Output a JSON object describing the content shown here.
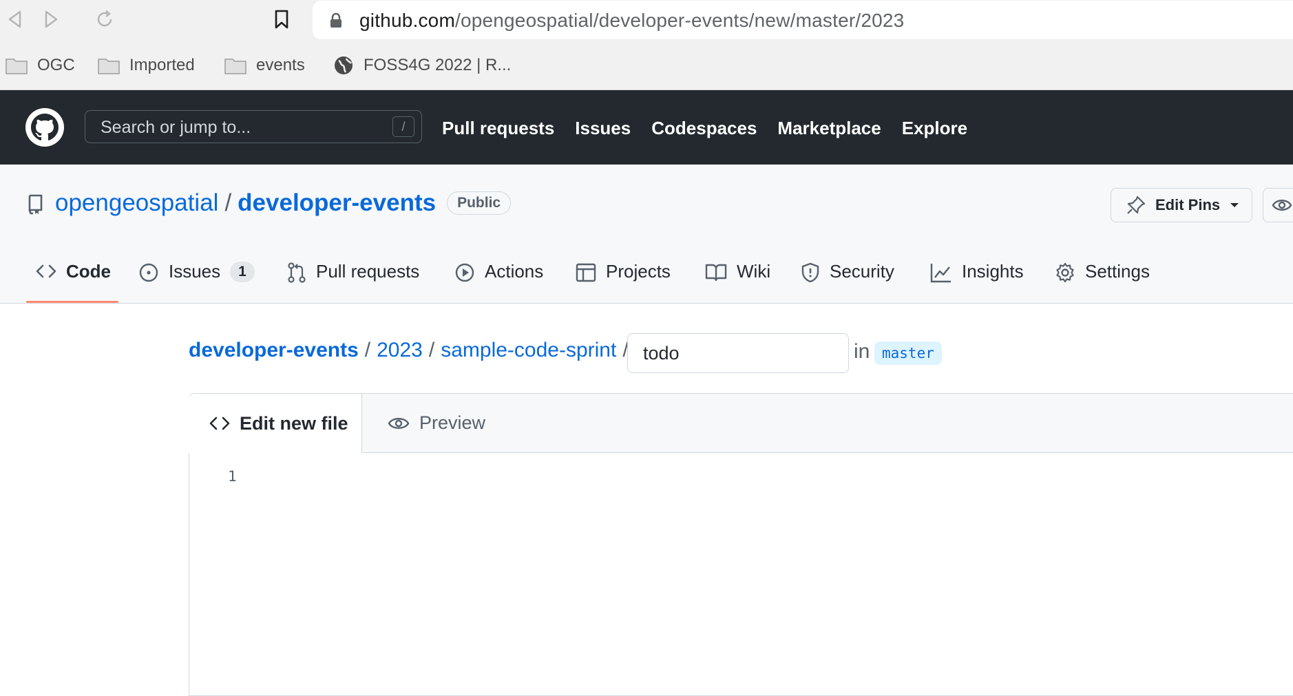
{
  "browser": {
    "url_host": "github.com",
    "url_path": "/opengeospatial/developer-events/new/master/2023",
    "bookmarks": [
      {
        "label": "OGC",
        "icon": "folder-icon"
      },
      {
        "label": "Imported",
        "icon": "folder-icon"
      },
      {
        "label": "events",
        "icon": "folder-icon"
      },
      {
        "label": "FOSS4G 2022 | R...",
        "icon": "globe-icon"
      }
    ]
  },
  "header": {
    "search_placeholder": "Search or jump to...",
    "search_shortcut": "/",
    "nav": [
      "Pull requests",
      "Issues",
      "Codespaces",
      "Marketplace",
      "Explore"
    ]
  },
  "repo": {
    "owner": "opengeospatial",
    "separator": "/",
    "name": "developer-events",
    "visibility": "Public",
    "edit_pins_label": "Edit Pins",
    "tabs": [
      {
        "label": "Code",
        "icon": "code-icon",
        "active": true
      },
      {
        "label": "Issues",
        "icon": "issue-icon",
        "count": "1"
      },
      {
        "label": "Pull requests",
        "icon": "pull-request-icon"
      },
      {
        "label": "Actions",
        "icon": "play-icon"
      },
      {
        "label": "Projects",
        "icon": "table-icon"
      },
      {
        "label": "Wiki",
        "icon": "book-icon"
      },
      {
        "label": "Security",
        "icon": "shield-icon"
      },
      {
        "label": "Insights",
        "icon": "graph-icon"
      },
      {
        "label": "Settings",
        "icon": "gear-icon"
      }
    ]
  },
  "breadcrumb": {
    "items": [
      "developer-events",
      "2023",
      "sample-code-sprint"
    ],
    "separator": "/",
    "filename_value": "todo",
    "in_label": "in",
    "branch": "master"
  },
  "editor": {
    "edit_tab_label": "Edit new file",
    "preview_tab_label": "Preview",
    "line_numbers": [
      "1"
    ]
  },
  "colors": {
    "header_bg": "#24292f",
    "link": "#0969da",
    "active_tab_underline": "#fd8c73"
  }
}
